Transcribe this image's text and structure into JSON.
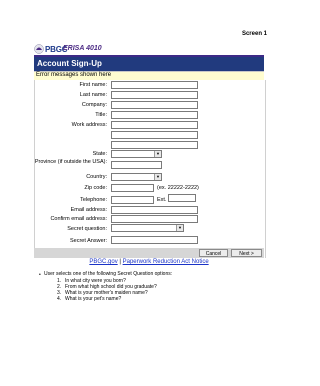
{
  "screen_label": "Screen 1",
  "logo": {
    "pbgc": "PBGC",
    "erisa": "ERISA 4010"
  },
  "header": {
    "title": "Account Sign-Up"
  },
  "error": {
    "message": "Error messages shown here"
  },
  "form": {
    "first_name": "First name:",
    "last_name": "Last name:",
    "company": "Company:",
    "title": "Title:",
    "work_address": "Work address:",
    "state": "State:",
    "province": "Province (if outside the USA):",
    "country": "Country:",
    "zip_code": "Zip code:",
    "zip_hint": "(ex. 22222-2222)",
    "telephone": "Telephone:",
    "ext": "Ext.",
    "email": "Email address:",
    "confirm_email": "Confirm email address:",
    "secret_question": "Secret question:",
    "secret_answer": "Secret Answer:"
  },
  "buttons": {
    "cancel": "Cancel",
    "next": "Next >"
  },
  "footer_links": {
    "pbgc": "PBGC.gov",
    "separator": "|",
    "paperwork": "Paperwork Reduction Act Notice"
  },
  "notes": {
    "intro": "User selects one of the following Secret Question options:",
    "questions": [
      {
        "num": "1.",
        "text": "In what city were you born?"
      },
      {
        "num": "2.",
        "text": "From what high school did you graduate?"
      },
      {
        "num": "3.",
        "text": "What is your mother's maiden name?"
      },
      {
        "num": "4.",
        "text": "What is your pet's name?"
      }
    ]
  }
}
